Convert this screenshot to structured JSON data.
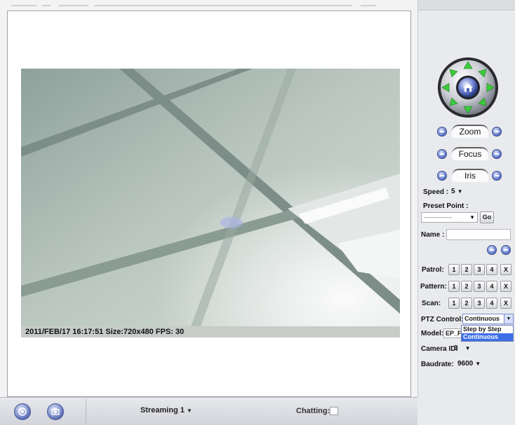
{
  "video": {
    "overlay_text": "2011/FEB/17 16:17:51 Size:720x480 FPS: 30"
  },
  "bottom_bar": {
    "icons": [
      "record-icon",
      "snapshot-icon"
    ],
    "stream_select": "Streaming 1",
    "chatting_label": "Chatting:",
    "chatting_checked": false
  },
  "ptz": {
    "joystick_icons": [
      "pan-tilt-arrows-icon",
      "home-icon"
    ],
    "zoom_label": "Zoom",
    "focus_label": "Focus",
    "iris_label": "Iris",
    "speed_label": "Speed :",
    "speed_value": "5",
    "preset_label": "Preset Point :",
    "preset_value": "---------------",
    "go_label": "Go",
    "name_label": "Name :",
    "name_value": "",
    "patrol_label": "Patrol:",
    "pattern_label": "Pattern:",
    "scan_label": "Scan:",
    "numbered_buttons": [
      "1",
      "2",
      "3",
      "4",
      "X"
    ],
    "ptz_control_label": "PTZ Control:",
    "ptz_control_value": "Continuous",
    "ptz_control_options": [
      "Step by Step",
      "Continuous"
    ],
    "model_label": "Model:",
    "model_value": "EP_F",
    "camera_id_label": "Camera ID:",
    "camera_id_value": "3",
    "baudrate_label": "Baudrate:",
    "baudrate_value": "9600"
  }
}
